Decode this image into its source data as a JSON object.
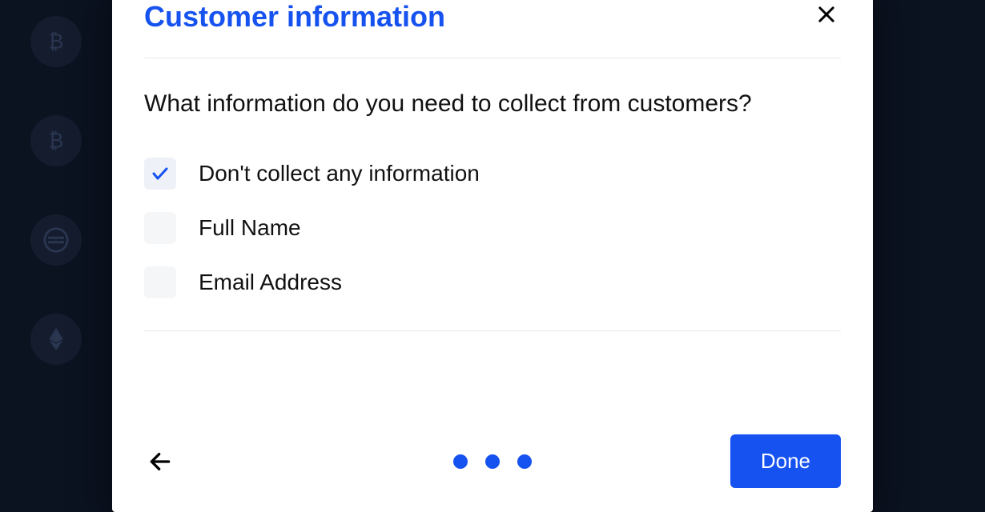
{
  "modal": {
    "title": "Customer information",
    "question": "What information do you need to collect from customers?",
    "options": [
      {
        "label": "Don't collect any information",
        "checked": true
      },
      {
        "label": "Full Name",
        "checked": false
      },
      {
        "label": "Email Address",
        "checked": false
      }
    ],
    "doneLabel": "Done",
    "pageDots": 3
  },
  "colors": {
    "accent": "#1652f0"
  }
}
